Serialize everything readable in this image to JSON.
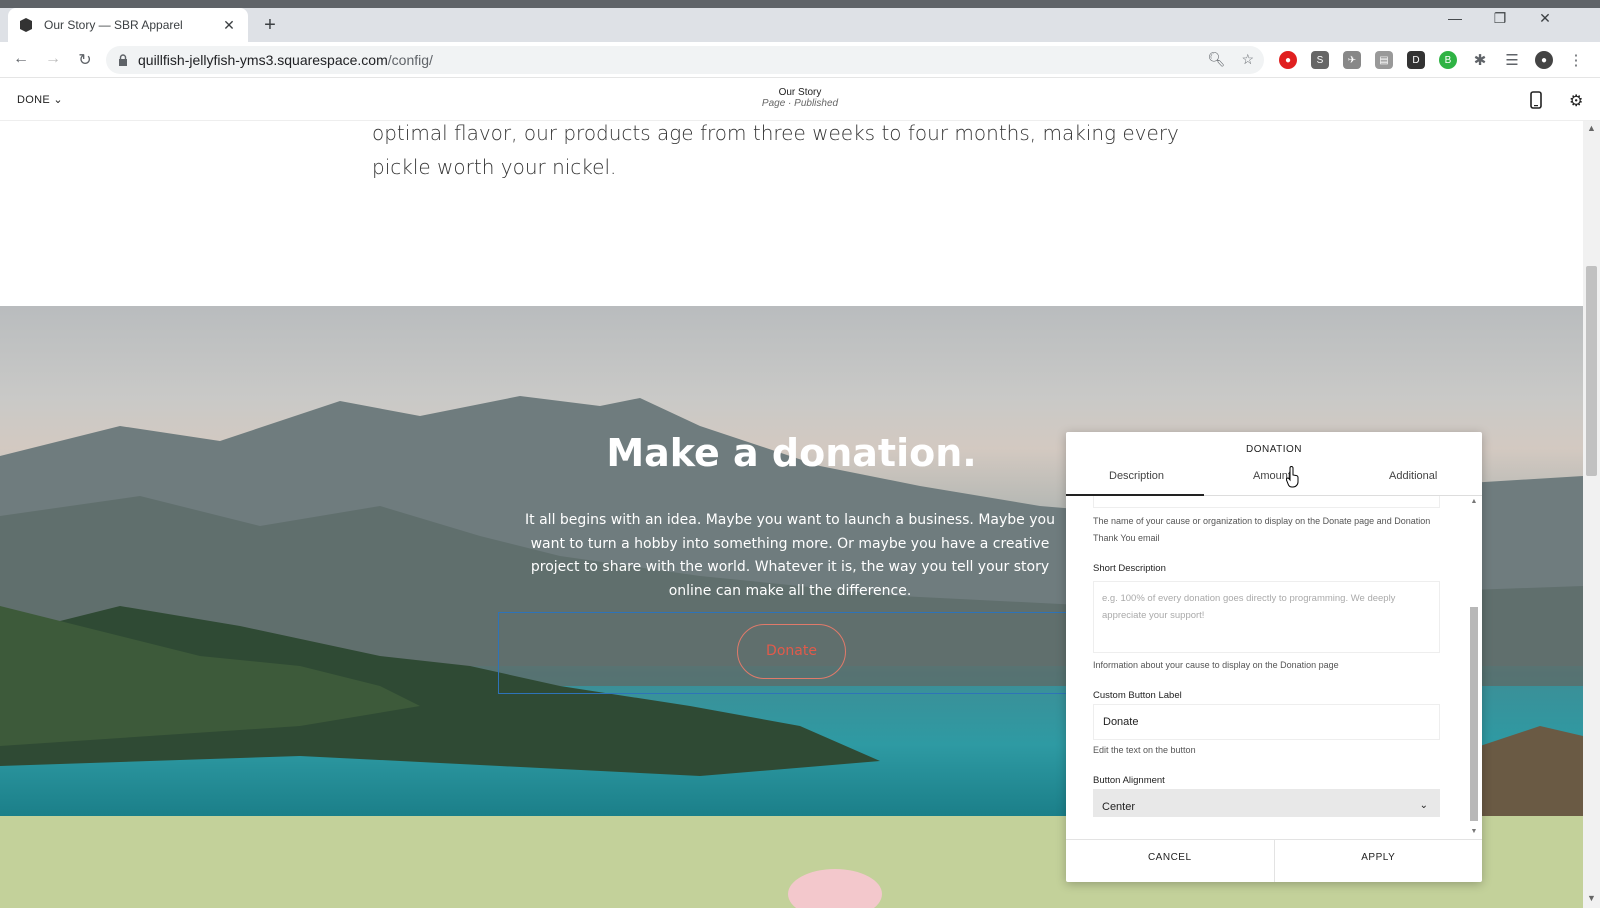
{
  "browser": {
    "tab_title": "Our Story — SBR Apparel",
    "url_host": "quillfish-jellyfish-yms3.squarespace.com",
    "url_path": "/config/"
  },
  "editor": {
    "done_label": "DONE",
    "page_title": "Our Story",
    "page_status": "Page · Published"
  },
  "page": {
    "intro_text": "optimal flavor, our products age from three weeks to four months, making every pickle worth your nickel.",
    "hero_title": "Make a donation.",
    "hero_text": "It all begins with an idea. Maybe you want to launch a business. Maybe you want to turn a hobby into something more. Or maybe you have a creative project to share with the world. Whatever it is, the way you tell your story online can make all the difference.",
    "donate_button": "Donate"
  },
  "panel": {
    "title": "DONATION",
    "tabs": [
      "Description",
      "Amount",
      "Additional"
    ],
    "active_tab": "Description",
    "name_help": "The name of your cause or organization to display on the Donate page and Donation Thank You email",
    "short_desc_label": "Short Description",
    "short_desc_placeholder": "e.g. 100% of every donation goes directly to programming. We deeply appreciate your support!",
    "short_desc_help": "Information about your cause to display on the Donation page",
    "button_label_label": "Custom Button Label",
    "button_label_value": "Donate",
    "button_label_help": "Edit the text on the button",
    "alignment_label": "Button Alignment",
    "alignment_value": "Center",
    "cancel": "CANCEL",
    "apply": "APPLY"
  }
}
